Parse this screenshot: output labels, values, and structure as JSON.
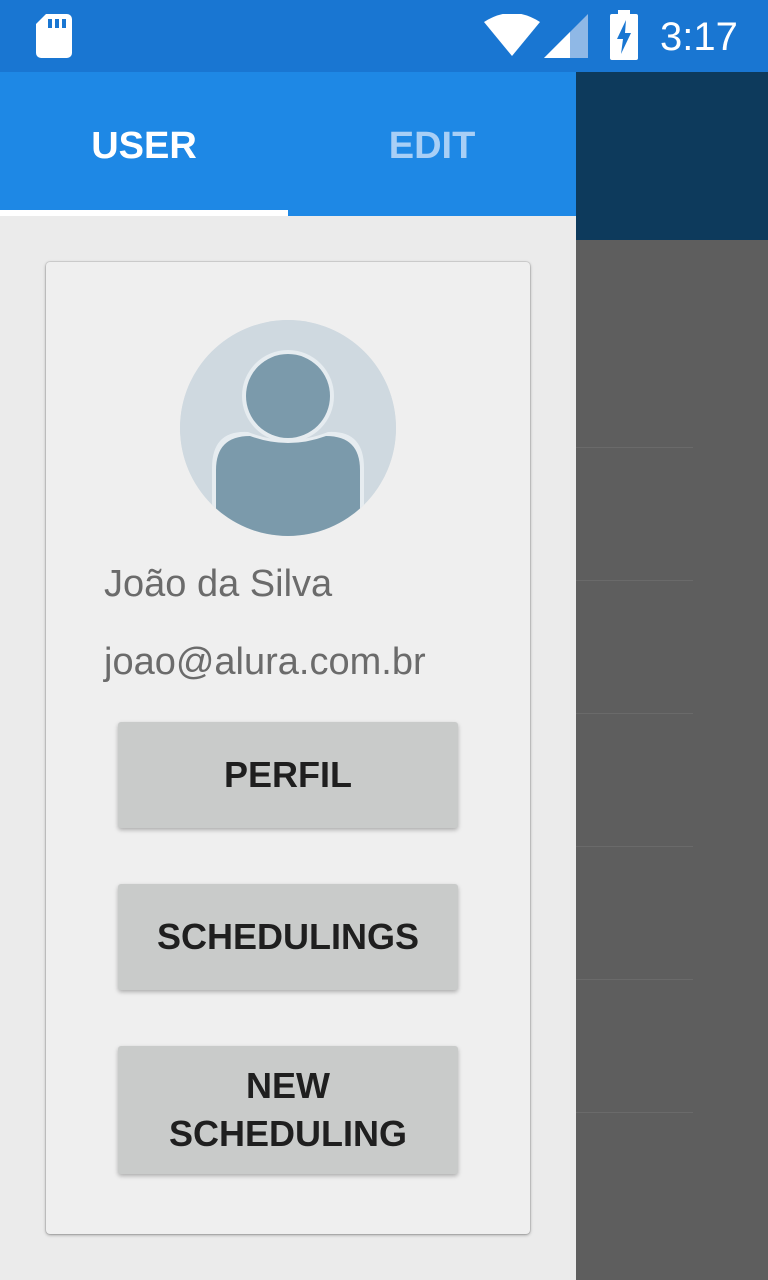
{
  "status_bar": {
    "time": "3:17",
    "icons": [
      "sd-card-icon",
      "wifi-icon",
      "signal-icon",
      "battery-charging-icon"
    ]
  },
  "drawer": {
    "tabs": [
      {
        "label": "USER",
        "selected": true
      },
      {
        "label": "EDIT",
        "selected": false
      }
    ],
    "profile": {
      "avatar_icon": "user-avatar-icon",
      "name": "João da Silva",
      "email": "joao@alura.com.br"
    },
    "buttons": {
      "perfil": "PERFIL",
      "schedulings": "SCHEDULINGS",
      "new_scheduling": "NEW SCHEDULING"
    }
  },
  "colors": {
    "status_bar": "#1976d2",
    "tab_bar": "#1e88e5",
    "app_toolbar_dimmed": "#0d3a5c",
    "scrim": "#5e5e5e",
    "button": "#c9cbca"
  }
}
